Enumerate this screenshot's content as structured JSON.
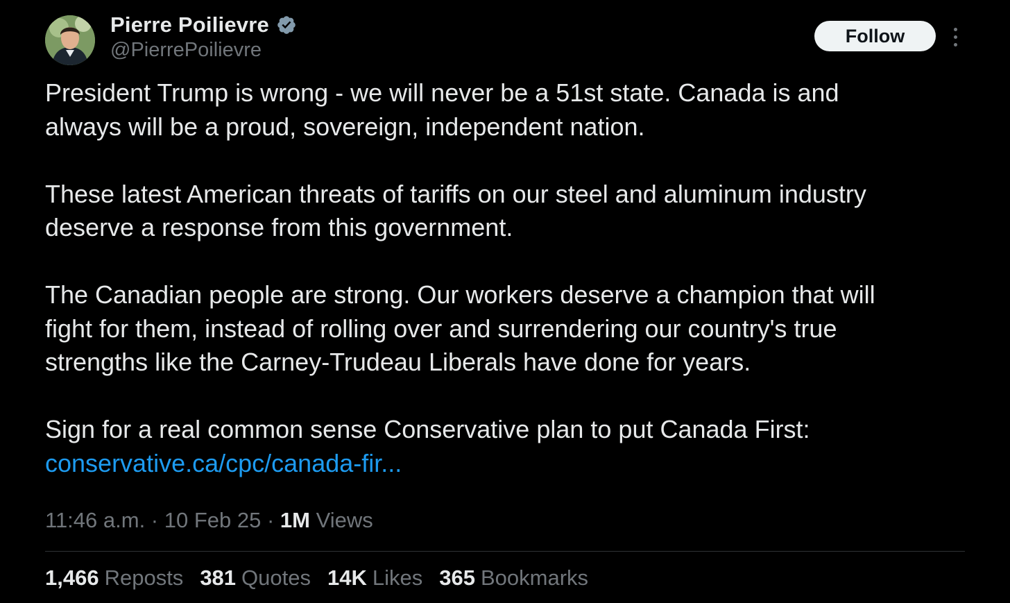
{
  "author": {
    "name": "Pierre Poilievre",
    "handle": "@PierrePoilievre",
    "verified_color": "#829aab"
  },
  "follow_label": "Follow",
  "tweet": {
    "paragraphs": [
      "President Trump is wrong - we will never be a 51st state. Canada is and\nalways will be a proud, sovereign, independent nation.",
      "These latest American threats of tariffs on our steel and aluminum industry\ndeserve a response from this government.",
      "The Canadian people are strong. Our workers deserve a champion that will\nfight for them, instead of rolling over and surrendering our country's true\nstrengths like the Carney-Trudeau Liberals have done for years.",
      "Sign for a real common sense Conservative plan to put Canada First:"
    ],
    "link": "conservative.ca/cpc/canada-fir..."
  },
  "meta": {
    "time": "11:46 a.m.",
    "sep1": " · ",
    "date": "10 Feb 25",
    "sep2": " · ",
    "views_count": "1M",
    "views_label": " Views"
  },
  "stats": [
    {
      "count": "1,466",
      "label": "Reposts"
    },
    {
      "count": "381",
      "label": "Quotes"
    },
    {
      "count": "14K",
      "label": "Likes"
    },
    {
      "count": "365",
      "label": "Bookmarks"
    }
  ],
  "colors": {
    "background": "#000000",
    "text": "#e7e9ea",
    "secondary": "#71767b",
    "link": "#1d9bf0"
  }
}
